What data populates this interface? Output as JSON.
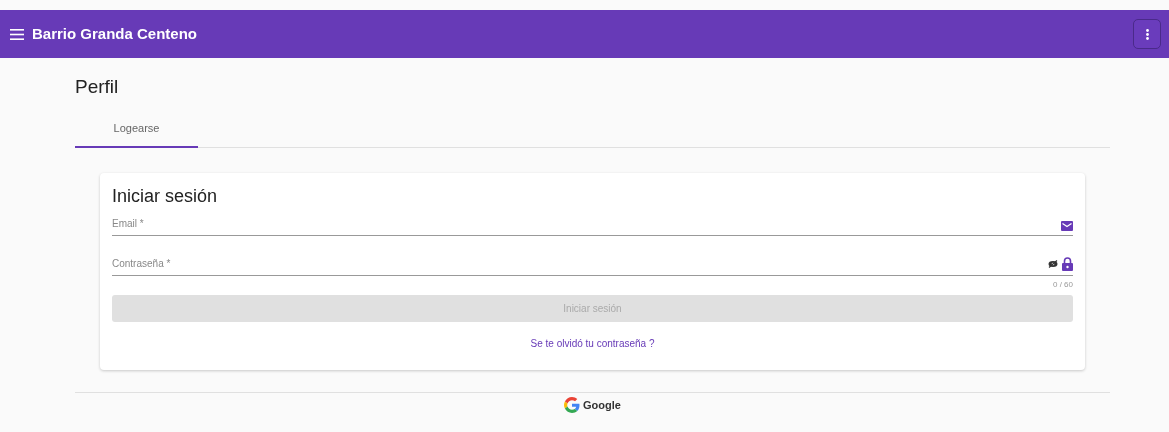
{
  "app_bar": {
    "title": "Barrio Granda Centeno"
  },
  "page_title": "Perfil",
  "tabs": [
    {
      "label": "Logearse",
      "selected": true
    }
  ],
  "login_card": {
    "title": "Iniciar sesión",
    "fields": [
      {
        "kind": "email",
        "placeholder": "Email *"
      },
      {
        "kind": "password",
        "placeholder": "Contraseña *",
        "counter": "0 / 60"
      }
    ],
    "submit": {
      "label": "Iniciar sesión",
      "disabled": true
    },
    "forgot_link": "Se te olvidó tu contraseña ?"
  },
  "social_login": {
    "label": "Google"
  }
}
